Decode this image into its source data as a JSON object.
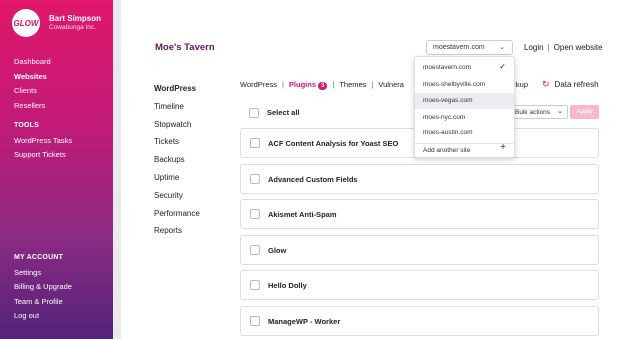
{
  "sidebar": {
    "logo_text": "GLOW",
    "user_name": "Bart Simpson",
    "user_org": "Cowabunga Inc.",
    "nav": [
      "Dashboard",
      "Websites",
      "Clients",
      "Resellers"
    ],
    "active_nav": "Websites",
    "tools_heading": "TOOLS",
    "tools": [
      "WordPress Tasks",
      "Support Tickets"
    ],
    "account_heading": "MY ACCOUNT",
    "account": [
      "Settings",
      "Billing & Upgrade",
      "Team & Profile",
      "Log out"
    ],
    "colors": {
      "gradient_top": "#e0176a",
      "gradient_bottom": "#52237a"
    }
  },
  "header": {
    "site_title": "Moe's Tavern",
    "site_select_value": "moestavern.com",
    "login_label": "Login",
    "open_website_label": "Open website"
  },
  "subnav": [
    "WordPress",
    "Timeline",
    "Stopwatch",
    "Tickets",
    "Backups",
    "Uptime",
    "Security",
    "Performance",
    "Reports"
  ],
  "tabs": {
    "wordpress": "WordPress",
    "plugins": "Plugins",
    "plugins_count": "3",
    "themes": "Themes",
    "vulnerabilities_partial": "Vulnera",
    "backup_partial": "ackup",
    "data_refresh": "Data refresh"
  },
  "toolbar": {
    "select_all": "Select all",
    "bulk_actions": "Bulk actions",
    "apply": "Apply"
  },
  "plugins": [
    "ACF Content Analysis for Yoast SEO",
    "Advanced Custom Fields",
    "Akismet Anti-Spam",
    "Glow",
    "Hello Dolly",
    "ManageWP - Worker"
  ],
  "dropdown": {
    "sites": [
      "moestavern.com",
      "moes-shelbyville.com",
      "moes-vegas.com",
      "moes-nyc.com",
      "moes-austin.com"
    ],
    "selected": "moestavern.com",
    "highlighted": "moes-vegas.com",
    "add_label": "Add another site"
  },
  "colors": {
    "accent": "#d6156a",
    "title": "#5a1a57",
    "apply_disabled": "#f6b8cc"
  }
}
